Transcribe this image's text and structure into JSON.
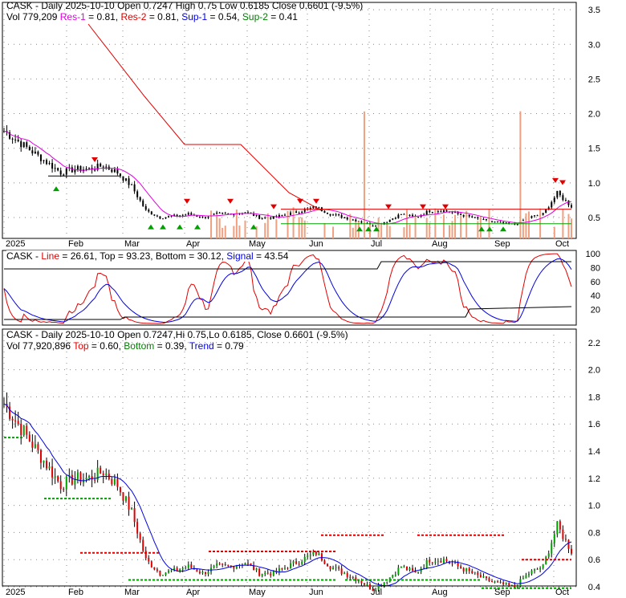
{
  "panel1": {
    "line1": "CASK - Daily 2025-10-10 Open 0.7247  High 0.75  Low 0.6185  Close 0.6601 (-9.5%)",
    "vol": "Vol 779,209",
    "res1_label": "Res-1",
    "res1": " = 0.81, ",
    "res2_label": "Res-2",
    "res2": " = 0.81, ",
    "sup1_label": "Sup-1",
    "sup1": " = 0.54, ",
    "sup2_label": "Sup-2",
    "sup2": " = 0.41"
  },
  "panel2": {
    "prefix": "CASK - ",
    "line_label": "Line",
    "line": " = 26.61, Top = 93.23, Bottom = 30.12, ",
    "signal_label": "Signal",
    "signal": " = 43.54"
  },
  "panel3": {
    "line1": "CASK - Daily 2025-10-10 Open 0.7247,Hi 0.75,Lo 0.6185, Close 0.6601 (-9.5%)",
    "vol": "Vol 77,920,896 ",
    "top_label": "Top",
    "top": " = 0.60, ",
    "bottom_label": "Bottom",
    "bottom": " = 0.39, ",
    "trend_label": "Trend",
    "trend": " = 0.79"
  },
  "chart_data": {
    "type": "line",
    "months": [
      "2025",
      "Feb",
      "Mar",
      "Apr",
      "May",
      "Jun",
      "Jul",
      "Aug",
      "Sep",
      "Oct"
    ],
    "weekly_close": [
      1.75,
      1.6,
      1.45,
      1.3,
      1.15,
      1.2,
      1.2,
      1.25,
      1.15,
      0.95,
      0.6,
      0.5,
      0.52,
      0.55,
      0.5,
      0.55,
      0.55,
      0.58,
      0.5,
      0.5,
      0.55,
      0.6,
      0.65,
      0.55,
      0.5,
      0.45,
      0.38,
      0.45,
      0.55,
      0.5,
      0.6,
      0.6,
      0.55,
      0.5,
      0.45,
      0.42,
      0.4,
      0.5,
      0.55,
      0.85,
      0.66
    ],
    "panel1_yticks": [
      "3.5",
      "3.0",
      "2.5",
      "2.0",
      "1.5",
      "1.0",
      "0.5"
    ],
    "panel2_yticks": [
      "100",
      "80",
      "60",
      "40",
      "20"
    ],
    "panel3_yticks": [
      "2.2",
      "2.0",
      "1.8",
      "1.6",
      "1.4",
      "1.2",
      "1.0",
      "0.8",
      "0.6",
      "0.4"
    ],
    "colors": {
      "up": "#00a000",
      "down": "#e00000",
      "res1": "#e000e0",
      "res2": "#e00000",
      "sup1": "#0000e0",
      "sup2": "#00a000"
    }
  }
}
